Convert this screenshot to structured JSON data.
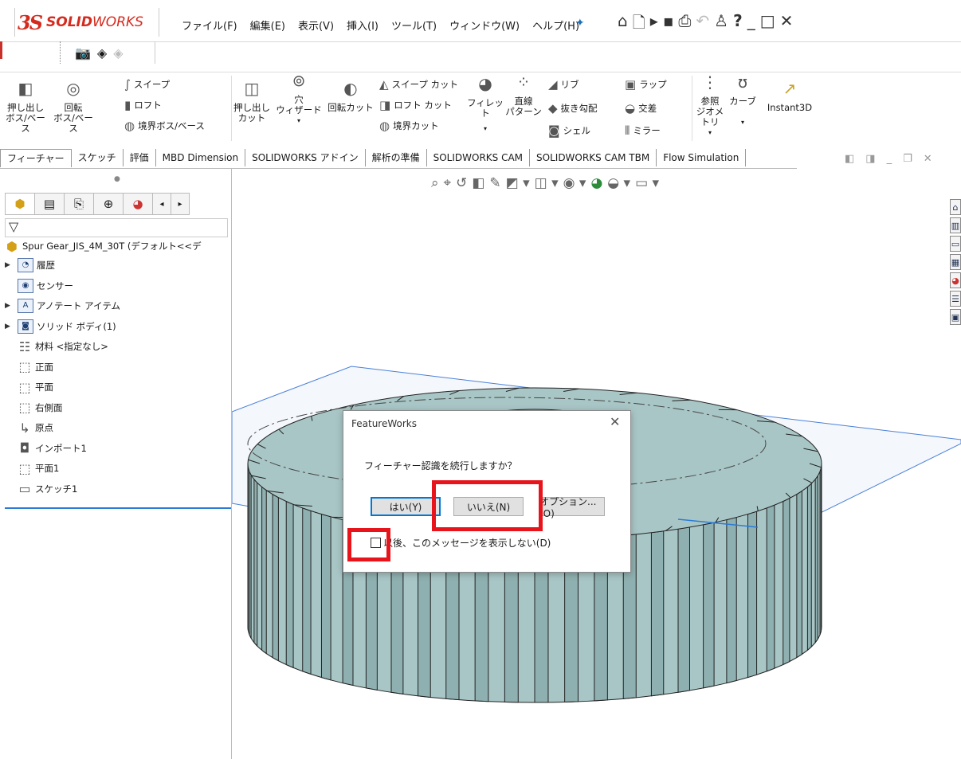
{
  "app": {
    "brand_ds": "3S",
    "brand_name_bold": "SOLID",
    "brand_name_rest": "WORKS"
  },
  "menu": [
    "ファイル(F)",
    "編集(E)",
    "表示(V)",
    "挿入(I)",
    "ツール(T)",
    "ウィンドウ(W)",
    "ヘルプ(H)"
  ],
  "ribbon": {
    "extrude_boss": "押し出し\nボス/ベース",
    "revolve_boss": "回転\nボス/ベース",
    "sweep": "スイープ",
    "loft": "ロフト",
    "boundary_boss": "境界ボス/ベース",
    "extrude_cut": "押し出し\nカット",
    "hole_wizard": "穴\nウィザード",
    "revolve_cut": "回転カット",
    "sweep_cut": "スイープ カット",
    "loft_cut": "ロフト カット",
    "boundary_cut": "境界カット",
    "fillet": "フィレット",
    "linear_pattern": "直線\nパターン",
    "rib": "リブ",
    "draft": "抜き勾配",
    "shell": "シェル",
    "wrap": "ラップ",
    "intersect": "交差",
    "mirror": "ミラー",
    "ref_geometry": "参照\nジオメトリ",
    "curves": "カーブ",
    "instant3d": "Instant3D"
  },
  "tabs": [
    "フィーチャー",
    "スケッチ",
    "評価",
    "MBD Dimension",
    "SOLIDWORKS アドイン",
    "解析の準備",
    "SOLIDWORKS CAM",
    "SOLIDWORKS CAM TBM",
    "Flow Simulation"
  ],
  "tree": {
    "root": "Spur Gear_JIS_4M_30T  (デフォルト<<デ",
    "items": [
      {
        "label": "履歴",
        "icon": "history-icon",
        "arrow": true
      },
      {
        "label": "センサー",
        "icon": "sensor-icon",
        "arrow": false
      },
      {
        "label": "アノテート アイテム",
        "icon": "annotation-icon",
        "arrow": true
      },
      {
        "label": "ソリッド ボディ(1)",
        "icon": "solid-body-icon",
        "arrow": true
      },
      {
        "label": "材料 <指定なし>",
        "icon": "material-icon",
        "arrow": false
      },
      {
        "label": "正面",
        "icon": "plane-icon",
        "arrow": false
      },
      {
        "label": "平面",
        "icon": "plane-icon",
        "arrow": false
      },
      {
        "label": "右側面",
        "icon": "plane-icon",
        "arrow": false
      },
      {
        "label": "原点",
        "icon": "origin-icon",
        "arrow": false
      },
      {
        "label": "インポート1",
        "icon": "import-icon",
        "arrow": false
      },
      {
        "label": "平面1",
        "icon": "plane-icon",
        "arrow": false
      },
      {
        "label": "スケッチ1",
        "icon": "sketch-icon",
        "arrow": false
      }
    ]
  },
  "dialog": {
    "title": "FeatureWorks",
    "message": "フィーチャー認識を続行しますか？",
    "yes": "はい(Y)",
    "no": "いいえ(N)",
    "options": "オプション...(O)",
    "checkbox_label": "以後、このメッセージを表示しない(D)"
  },
  "colors": {
    "brand": "#d52b1e",
    "gear": "#a9c6c6",
    "highlight": "#e8141b",
    "selection_blue": "#2a7bd6"
  }
}
